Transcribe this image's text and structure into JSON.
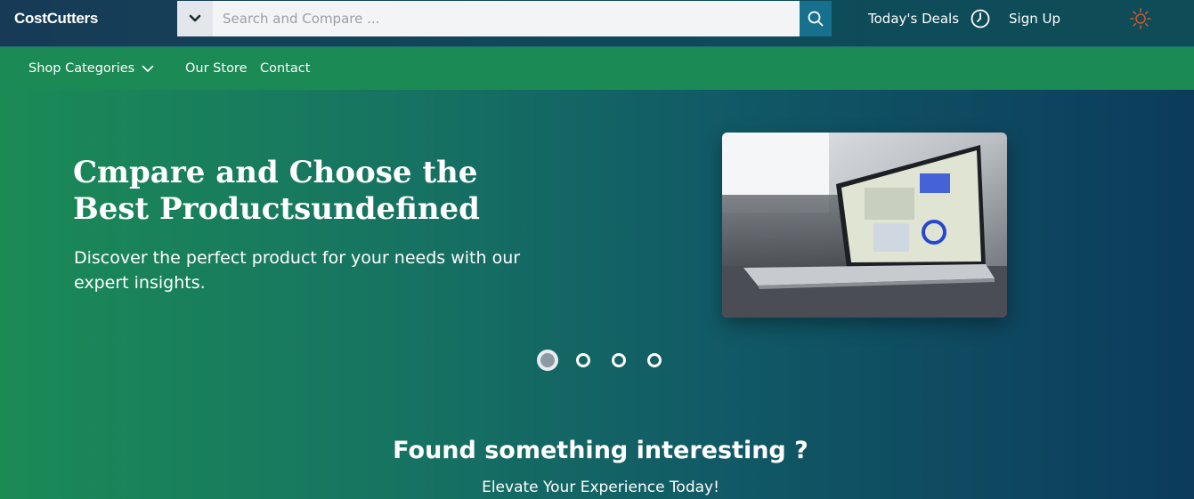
{
  "header": {
    "logo": "CostCutters",
    "search_placeholder": "Search and Compare ...",
    "search_value": "",
    "deals_label": "Today's Deals",
    "signup_label": "Sign Up"
  },
  "nav": {
    "categories_label": "Shop Categories",
    "store_label": "Our Store",
    "contact_label": "Contact"
  },
  "hero": {
    "title": "Cmpare and Choose the Best Productsundefined",
    "subtitle": "Discover the perfect product for your needs with our expert insights.",
    "carousel_active_index": 0,
    "carousel_count": 4
  },
  "cta": {
    "title": "Found something interesting ?",
    "subtitle": "Elevate Your Experience Today!"
  },
  "colors": {
    "topbar": "#173a56",
    "navbar": "#1b8a55",
    "search_button": "#17708e",
    "sun_icon": "#d9532b"
  },
  "icons": {
    "dropdown": "chevron-down-icon",
    "search": "search-icon",
    "clock": "clock-icon",
    "theme": "sun-icon",
    "categories": "chevron-down-icon"
  }
}
